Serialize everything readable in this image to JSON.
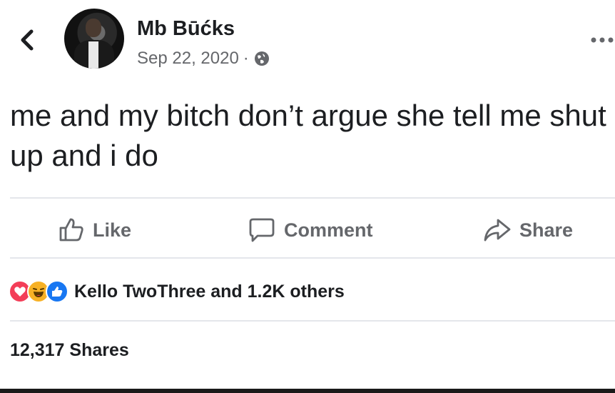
{
  "post": {
    "author": "Mb Būćks",
    "date": "Sep 22, 2020",
    "separator": "·",
    "privacy_icon": "globe-icon",
    "text": "me and my bitch don’t argue she tell me shut up and i do"
  },
  "actions": {
    "like_label": "Like",
    "comment_label": "Comment",
    "share_label": "Share"
  },
  "reactions": {
    "icons": [
      "love-icon",
      "haha-icon",
      "like-reaction-icon"
    ],
    "summary": "Kello TwoThree and 1.2K others"
  },
  "shares": {
    "label": "12,317 Shares"
  },
  "colors": {
    "text": "#1c1e21",
    "secondary": "#65676b",
    "love": "#f33e58",
    "haha": "#f7b125",
    "like_blue": "#1877f2",
    "divider": "#e4e6eb"
  }
}
